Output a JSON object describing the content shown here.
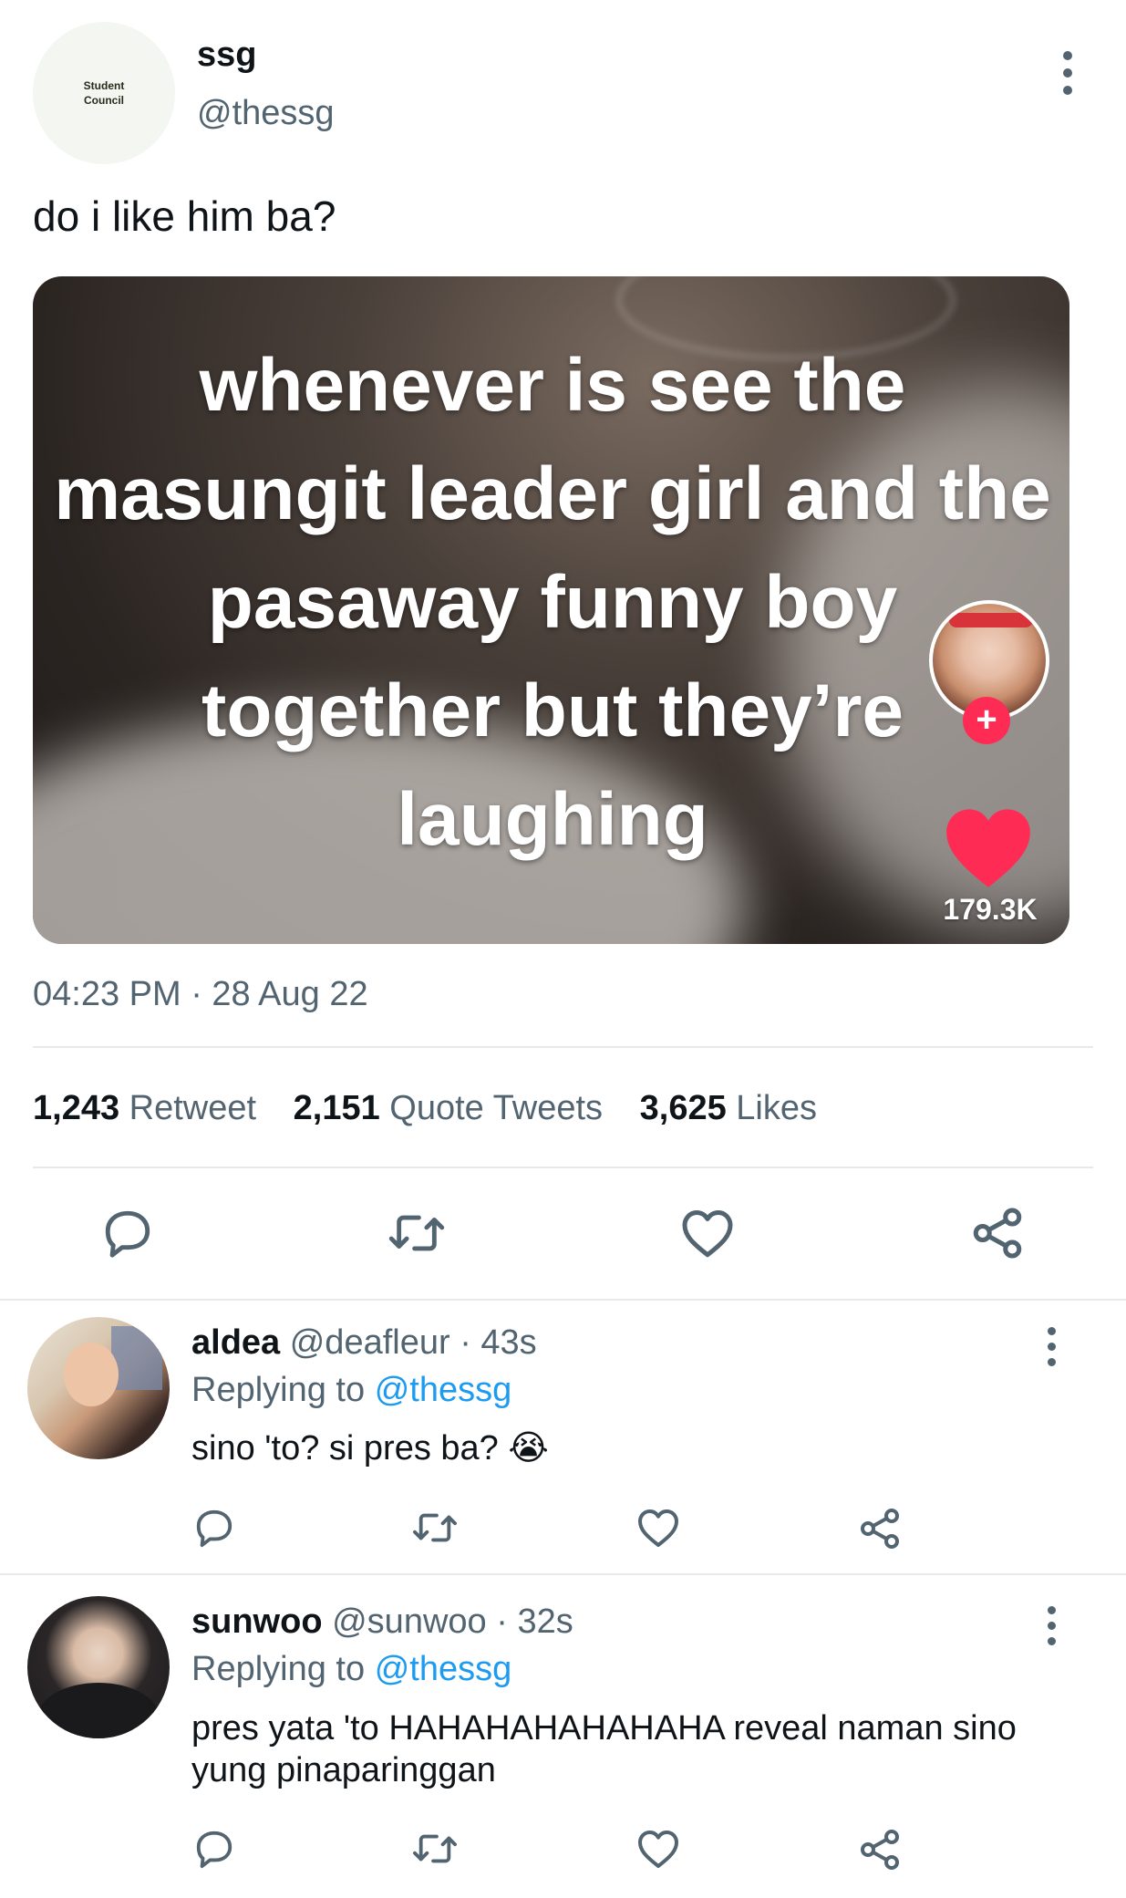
{
  "tweet": {
    "avatar_text": "Student Council",
    "display_name": "ssg",
    "handle": "@thessg",
    "text": "do i like him ba?",
    "media": {
      "caption_lines": [
        "whenever is see the",
        "masungit leader girl and the",
        "pasaway funny boy",
        "together but they’re",
        "laughing"
      ],
      "like_count": "179.3K"
    },
    "timestamp": "04:23 PM · 28 Aug 22",
    "stats": {
      "retweets": "1,243",
      "retweets_label": "Retweet",
      "quotes": "2,151",
      "quotes_label": "Quote Tweets",
      "likes": "3,625",
      "likes_label": "Likes"
    }
  },
  "replies": [
    {
      "display_name": "aldea",
      "handle": "@deafleur",
      "time": "· 43s",
      "replying_prefix": "Replying to",
      "replying_to": "@thessg",
      "text": "sino 'to? si pres ba? 😭"
    },
    {
      "display_name": "sunwoo",
      "handle": "@sunwoo",
      "time": "· 32s",
      "replying_prefix": "Replying to",
      "replying_to": "@thessg",
      "text": "pres yata 'to HAHAHAHAHAHAHA reveal naman sino yung pinaparinggan"
    }
  ],
  "icons": [
    "more-icon",
    "reply-icon",
    "retweet-icon",
    "like-icon",
    "share-icon",
    "heart-filled-icon",
    "follow-plus-icon"
  ],
  "colors": {
    "accent": "#1d9bf0",
    "text_secondary": "#536471",
    "tiktok_heart": "#fe2c55"
  }
}
